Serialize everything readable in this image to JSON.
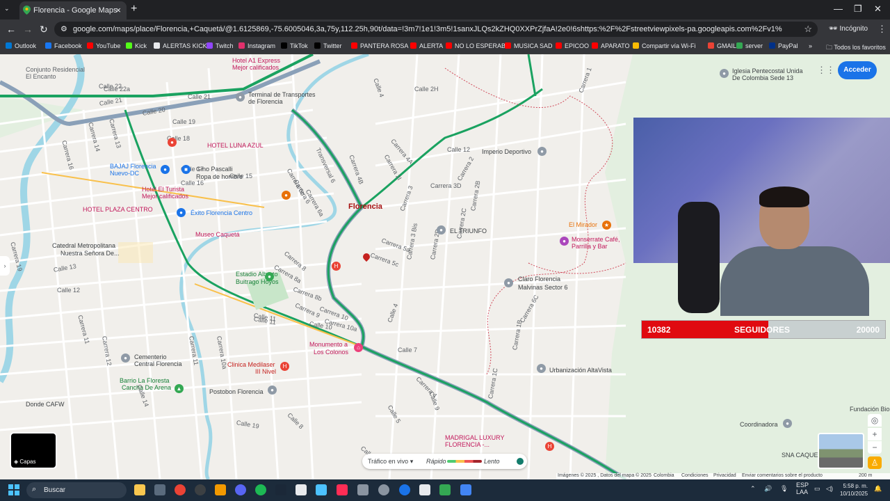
{
  "browser": {
    "tab_title": "Florencia - Google Maps",
    "url": "google.com/maps/place/Florencia,+Caquetá/@1.6125869,-75.6005046,3a,75y,112.25h,90t/data=!3m7!1e1!3m5!1sanxJLQs2kZHQ0XXPrZjfaA!2e0!6shttps:%2F%2Fstreetviewpixels-pa.googleapis.com%2Fv1%2Fthumbnail%3Fcb_client%3Dmaps_sv.tactile%...",
    "incognito_label": "Incógnito",
    "all_bookmarks": "Todos los favoritos",
    "bookmarks": [
      {
        "label": "Outlook",
        "color": "#0078d4"
      },
      {
        "label": "Facebook",
        "color": "#1877f2"
      },
      {
        "label": "YouTube",
        "color": "#ff0000"
      },
      {
        "label": "Kick",
        "color": "#53fc18"
      },
      {
        "label": "ALERTAS KICK",
        "color": "#e8eaed"
      },
      {
        "label": "Twitch",
        "color": "#9146ff"
      },
      {
        "label": "Instagram",
        "color": "#e1306c"
      },
      {
        "label": "TikTok",
        "color": "#000000"
      },
      {
        "label": "Twitter",
        "color": "#000000"
      },
      {
        "label": "PANTERA ROSA",
        "color": "#ff0000"
      },
      {
        "label": "ALERTA",
        "color": "#ff0000"
      },
      {
        "label": "NO LO ESPERABA",
        "color": "#ff0000"
      },
      {
        "label": "MUSICA SAD",
        "color": "#ff0000"
      },
      {
        "label": "EPICOO",
        "color": "#ff0000"
      },
      {
        "label": "APARATO",
        "color": "#ff0000"
      },
      {
        "label": "Compartir vía Wi-Fi",
        "color": "#fbbc04"
      },
      {
        "label": "GMAILL",
        "color": "#ea4335"
      },
      {
        "label": "server",
        "color": "#34a853"
      },
      {
        "label": "PayPal",
        "color": "#003087"
      }
    ]
  },
  "map": {
    "city_label": "Florencia",
    "acceder_label": "Acceder",
    "layers_label": "Capas",
    "traffic": {
      "live_label": "Tráfico en vivo",
      "fast_label": "Rápido",
      "slow_label": "Lento"
    },
    "attribution": [
      "Imágenes © 2025 , Datos del mapa © 2025",
      "Colombia",
      "Condiciones",
      "Privacidad",
      "Enviar comentarios sobre el producto",
      "200 m"
    ],
    "places": [
      {
        "text": "Conjunto Residencial",
        "kind": "lbl"
      },
      {
        "text": "El Encanto",
        "kind": "lbl"
      },
      {
        "text": "Hotel A1 Express",
        "kind": "pink"
      },
      {
        "text": "Mejor calificados",
        "kind": "pink"
      },
      {
        "text": "Terminal de Transportes",
        "kind": "dark"
      },
      {
        "text": "de Florencia",
        "kind": "dark"
      },
      {
        "text": "HOTEL LUNA AZUL",
        "kind": "pink"
      },
      {
        "text": "BAJAJ Florencia",
        "kind": "blue"
      },
      {
        "text": "Nuevo-DC",
        "kind": "blue"
      },
      {
        "text": "Gino Pascalli",
        "kind": "dark"
      },
      {
        "text": "Ropa de hombre",
        "kind": "dark"
      },
      {
        "text": "Hotel El Turista",
        "kind": "pink"
      },
      {
        "text": "Mejor calificados",
        "kind": "pink"
      },
      {
        "text": "HOTEL PLAZA CENTRO",
        "kind": "pink"
      },
      {
        "text": "Éxito Florencia Centro",
        "kind": "blue"
      },
      {
        "text": "Museo Caquetá",
        "kind": "pink"
      },
      {
        "text": "Catedral Metropolitana",
        "kind": "dark"
      },
      {
        "text": "Nuestra Señora De...",
        "kind": "dark"
      },
      {
        "text": "Estadio Alberto",
        "kind": "green"
      },
      {
        "text": "Buitrago Hoyos",
        "kind": "green"
      },
      {
        "text": "Monumento a",
        "kind": "pink"
      },
      {
        "text": "Los Colonos",
        "kind": "pink"
      },
      {
        "text": "Clinica Medilaser",
        "kind": "red"
      },
      {
        "text": "III Nivel",
        "kind": "red"
      },
      {
        "text": "Cementerio",
        "kind": "dark"
      },
      {
        "text": "Central Florencia",
        "kind": "dark"
      },
      {
        "text": "Barrio La Floresta",
        "kind": "green"
      },
      {
        "text": "Cancha De Arena",
        "kind": "green"
      },
      {
        "text": "Donde CAFW",
        "kind": "dark"
      },
      {
        "text": "Postobon Florencia",
        "kind": "dark"
      },
      {
        "text": "Imperio Deportivo",
        "kind": "dark"
      },
      {
        "text": "EL TRIUNFO",
        "kind": "dark"
      },
      {
        "text": "Claro Florencia",
        "kind": "dark"
      },
      {
        "text": "Malvinas Sector 6",
        "kind": "dark"
      },
      {
        "text": "El Mirador",
        "kind": "orange"
      },
      {
        "text": "Monserrate Café,",
        "kind": "pink"
      },
      {
        "text": "Parrilla y Bar",
        "kind": "pink"
      },
      {
        "text": "Urbanización AltaVista",
        "kind": "dark"
      },
      {
        "text": "Iglesia Pentecostal Unida",
        "kind": "dark"
      },
      {
        "text": "De Colombia Sede 13",
        "kind": "dark"
      },
      {
        "text": "MADRIGAL LUXURY",
        "kind": "pink"
      },
      {
        "text": "FLORENCIA -...",
        "kind": "pink"
      },
      {
        "text": "Coordinadora",
        "kind": "dark"
      },
      {
        "text": "SNA CAQUETA",
        "kind": "dark"
      },
      {
        "text": "Fundación Bio",
        "kind": "dark"
      }
    ],
    "streets": [
      "Calle 21",
      "Calle 22",
      "Calle 22a",
      "Calle 20",
      "Calle 21",
      "Calle 19",
      "Carrera 14",
      "Carrera 16",
      "Calle 18",
      "Carrera 13",
      "Calle 17",
      "Calle 16",
      "Calle 15",
      "Carrera 19",
      "Calle 13",
      "Calle 12",
      "Carrera 11",
      "Carrera 12",
      "Calle 11",
      "Calle 10",
      "Carrera 8",
      "Carrera 8a",
      "Carrera 8b",
      "Carrera 9",
      "Carrera 10",
      "Carrera 10a",
      "Carrera 6",
      "Carrera 6a",
      "Carrera 6c",
      "Transversal 6",
      "Calle 4",
      "Carrera 4B",
      "Calle 2H",
      "Carrera 4A",
      "Carrera 2I",
      "Calle 12",
      "Carrera 2",
      "Carrera 3D",
      "Carrera 5a",
      "Carrera 5c",
      "Carrera 3",
      "Carrera 3 Bis",
      "Carrera 2D",
      "Carrera 2C",
      "Carrera 2B",
      "Carrera 1",
      "Calle 4",
      "Calle 7",
      "Calle 9",
      "Carrera 10a",
      "Carrera 11",
      "Calle 11",
      "Calle 14",
      "Calle 19",
      "Calle 8",
      "Calle 6",
      "Calle 5",
      "Carrera 4",
      "Carrera 6C",
      "Carrera 1B",
      "Carrera 1C"
    ],
    "webcam_banner": {
      "current": "10382",
      "label": "SEGUIDORES",
      "goal": "20000",
      "progress": 0.5191
    }
  },
  "taskbar": {
    "search_label": "Buscar",
    "lang": "ESP",
    "lang2": "LAA",
    "time": "5:58 p. m.",
    "date": "10/10/2025"
  }
}
